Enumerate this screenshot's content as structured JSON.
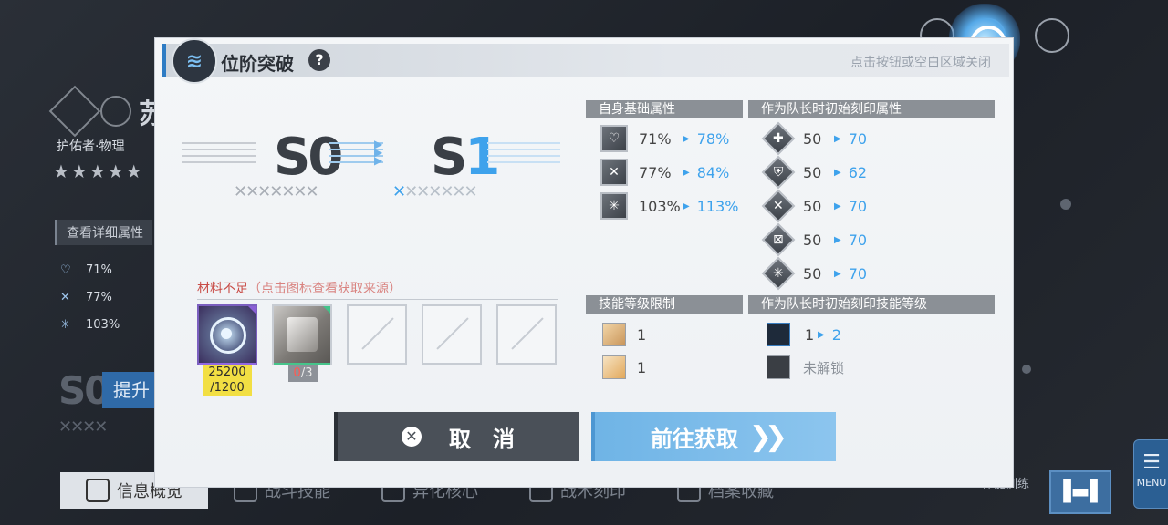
{
  "background": {
    "char_name": "苏",
    "char_class": "护佑者·物理",
    "stars": "★★★★★",
    "detail_button": "查看详细属性",
    "stats": [
      {
        "icon": "heart-icon",
        "value": "71%"
      },
      {
        "icon": "sword-icon",
        "value": "77%"
      },
      {
        "icon": "snowflake-icon",
        "value": "103%"
      }
    ],
    "rank": "S0",
    "upgrade_label": "提升",
    "tabs": [
      {
        "label": "信息概览",
        "active": true
      },
      {
        "label": "战斗技能",
        "active": false
      },
      {
        "label": "异化核心",
        "active": false
      },
      {
        "label": "战术刻印",
        "active": false
      },
      {
        "label": "档案收藏",
        "active": false
      }
    ],
    "train_label": "伴能训练",
    "menu_label": "MENU"
  },
  "dialog": {
    "title": "位阶突破",
    "close_hint": "点击按钮或空白区域关闭",
    "rank_from": "S0",
    "rank_to_prefix": "S",
    "rank_to_num": "1",
    "materials_label": "材料不足",
    "materials_hint": "（点击图标查看获取来源）",
    "materials": [
      {
        "name": "core-material",
        "have": "25200",
        "need": "/1200",
        "rarity_color": "#8a5fd6"
      },
      {
        "name": "cube-material",
        "have": "0",
        "need": "/3",
        "rarity_color": "#42c38a"
      }
    ],
    "base_attr_header": "自身基础属性",
    "base_attrs": [
      {
        "icon": "heart-icon",
        "old": "71%",
        "new": "78%"
      },
      {
        "icon": "sword-icon",
        "old": "77%",
        "new": "84%"
      },
      {
        "icon": "snowflake-icon",
        "old": "103%",
        "new": "113%"
      }
    ],
    "leader_attr_header": "作为队长时初始刻印属性",
    "leader_attrs": [
      {
        "icon": "cross-shield-icon",
        "old": "50",
        "new": "70"
      },
      {
        "icon": "shield-icon",
        "old": "50",
        "new": "62"
      },
      {
        "icon": "swords-icon",
        "old": "50",
        "new": "70"
      },
      {
        "icon": "x-shield-icon",
        "old": "50",
        "new": "70"
      },
      {
        "icon": "snow-shield-icon",
        "old": "50",
        "new": "70"
      }
    ],
    "skill_limit_header": "技能等级限制",
    "skill_limits": [
      {
        "icon": "skill-heart-icon",
        "value": "1"
      },
      {
        "icon": "skill-star-icon",
        "value": "1"
      }
    ],
    "leader_skill_header": "作为队长时初始刻印技能等级",
    "leader_skills": [
      {
        "icon": "skill-core-icon",
        "old": "1",
        "new": "2"
      },
      {
        "icon": "skill-locked-icon",
        "status": "未解锁"
      }
    ],
    "cancel_label": "取　消",
    "go_label": "前往获取",
    "colors": {
      "accent": "#3ea2ec",
      "warning": "#c94d48",
      "highlight": "#f2df43"
    }
  }
}
